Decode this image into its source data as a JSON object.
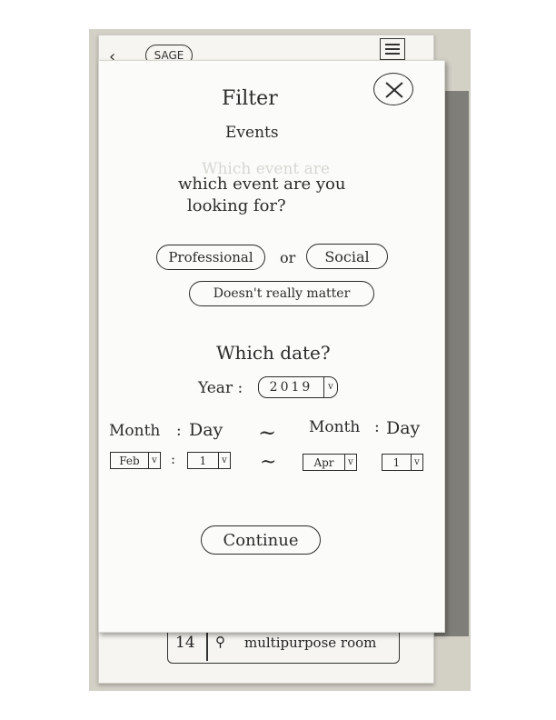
{
  "back_sheet": {
    "back_icon": "chevron-left",
    "pill_label": "SAGE",
    "menu_icon": "menu",
    "row_number": "14",
    "row_pin_icon": "location-pin",
    "row_room": "multipurpose room"
  },
  "filter": {
    "title": "Filter",
    "subtitle": "Events",
    "close_icon": "close-x",
    "ghost_text": "Which event are",
    "question": {
      "line1": "which event are you",
      "line2": "looking for?"
    },
    "options": {
      "professional": "Professional",
      "or": "or",
      "social": "Social",
      "any": "Doesn't really matter"
    },
    "date": {
      "heading": "Which date?",
      "year_label": "Year :",
      "year_value": "2019",
      "start_month_label": "Month",
      "start_colon": ":",
      "start_day_label": "Day",
      "range_symbol": "~",
      "end_month_label": "Month",
      "end_colon": ":",
      "end_day_label": "Day",
      "start_month_value": "Feb",
      "start_sel_colon": ":",
      "start_day_value": "1",
      "end_month_value": "Apr",
      "end_day_value": "1",
      "dropdown_icon": "chevron-down"
    },
    "continue_label": "Continue"
  }
}
